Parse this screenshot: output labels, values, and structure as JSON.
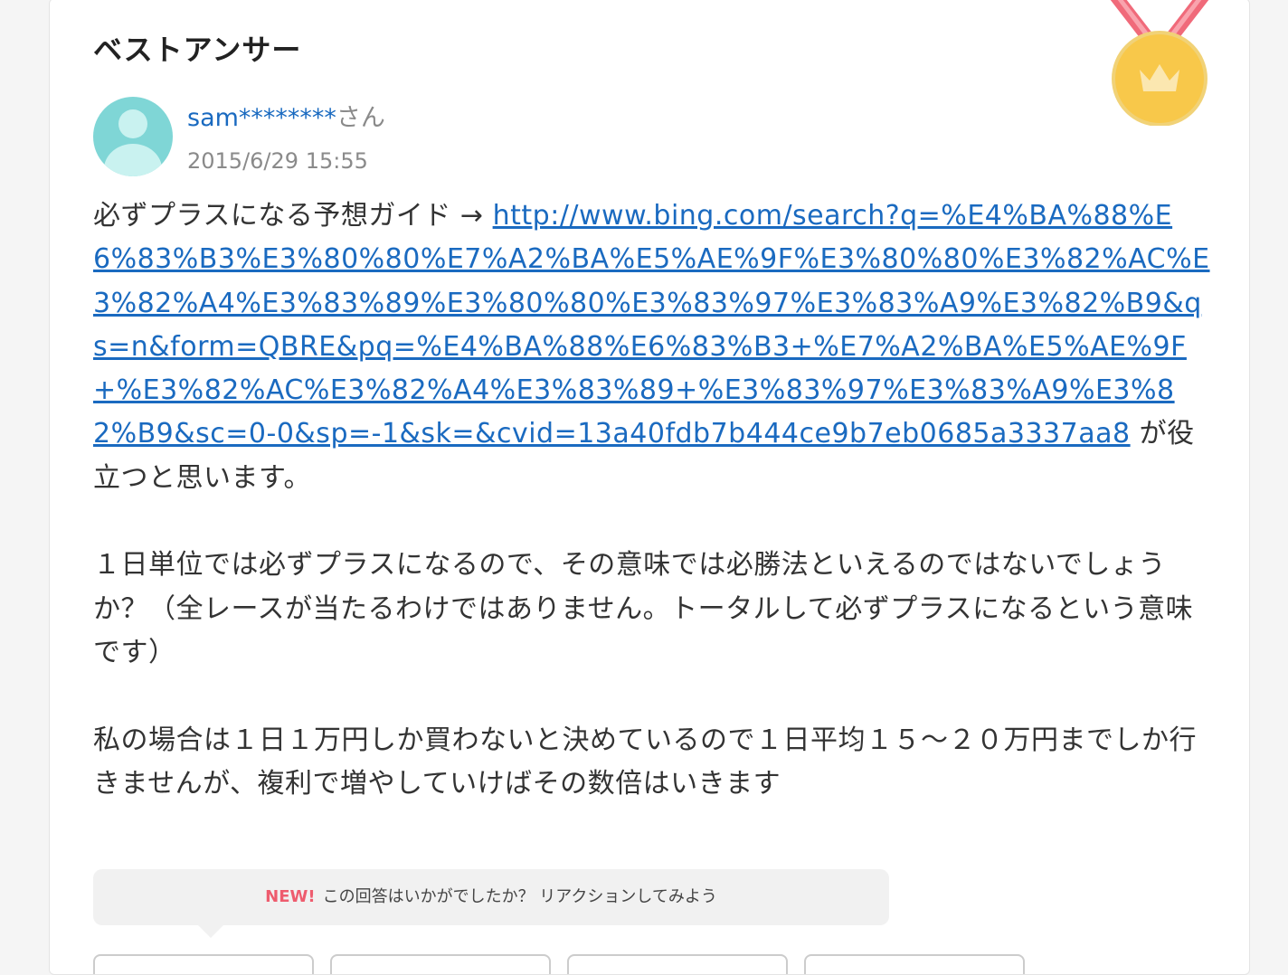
{
  "answer": {
    "heading": "ベストアンサー",
    "medal_icon": "crown-medal-icon",
    "author": {
      "avatar_icon": "default-user-avatar-icon",
      "name": "sam********",
      "suffix": "さん",
      "date": "2015/6/29 15:55"
    },
    "body": {
      "intro": "必ずプラスになる予想ガイド → ",
      "link": "http://www.bing.com/search?q=%E4%BA%88%E6%83%B3%E3%80%80%E7%A2%BA%E5%AE%9F%E3%80%80%E3%82%AC%E3%82%A4%E3%83%89%E3%80%80%E3%83%97%E3%83%A9%E3%82%B9&qs=n&form=QBRE&pq=%E4%BA%88%E6%83%B3+%E7%A2%BA%E5%AE%9F+%E3%82%AC%E3%82%A4%E3%83%89+%E3%83%97%E3%83%A9%E3%82%B9&sc=0-0&sp=-1&sk=&cvid=13a40fdb7b444ce9b7eb0685a3337aa8",
      "after_link": " が役立つと思います。",
      "paragraph2": "１日単位では必ずプラスになるので、その意味では必勝法といえるのではないでしょうか？（全レースが当たるわけではありません。トータルして必ずプラスになるという意味です）",
      "paragraph3": "私の場合は１日１万円しか買わないと決めているので１日平均１５～２０万円までしか行きませんが、複利で増やしていけばその数倍はいきます"
    }
  },
  "reaction": {
    "new_label": "NEW!",
    "prompt": "この回答はいかがでしたか？ リアクションしてみよう"
  },
  "colors": {
    "link": "#1a6ac0",
    "new_badge": "#ee5c6e",
    "medal_gold": "#f8c84a",
    "medal_ribbon": "#f06a7a",
    "avatar_bg": "#7fd6d6"
  }
}
